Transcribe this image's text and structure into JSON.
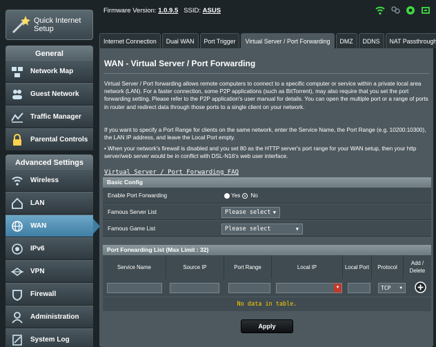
{
  "sidebar": {
    "quick_setup": "Quick Internet Setup",
    "general_header": "General",
    "general_items": [
      {
        "label": "Network Map",
        "icon": "network-map-icon"
      },
      {
        "label": "Guest Network",
        "icon": "guest-network-icon"
      },
      {
        "label": "Traffic Manager",
        "icon": "traffic-manager-icon"
      },
      {
        "label": "Parental Controls",
        "icon": "parental-controls-icon"
      }
    ],
    "advanced_header": "Advanced Settings",
    "advanced_items": [
      {
        "label": "Wireless",
        "icon": "wireless-icon"
      },
      {
        "label": "LAN",
        "icon": "lan-icon"
      },
      {
        "label": "WAN",
        "icon": "wan-icon",
        "active": true
      },
      {
        "label": "IPv6",
        "icon": "ipv6-icon"
      },
      {
        "label": "VPN",
        "icon": "vpn-icon"
      },
      {
        "label": "Firewall",
        "icon": "firewall-icon"
      },
      {
        "label": "Administration",
        "icon": "administration-icon"
      },
      {
        "label": "System Log",
        "icon": "system-log-icon"
      }
    ]
  },
  "header": {
    "firmware_label": "Firmware Version:",
    "firmware_value": "1.0.9.5",
    "ssid_label": "SSID:",
    "ssid_value": "ASUS"
  },
  "tabs": [
    {
      "label": "Internet Connection"
    },
    {
      "label": "Dual WAN"
    },
    {
      "label": "Port Trigger"
    },
    {
      "label": "Virtual Server / Port Forwarding",
      "active": true
    },
    {
      "label": "DMZ"
    },
    {
      "label": "DDNS"
    },
    {
      "label": "NAT Passthrough"
    }
  ],
  "main": {
    "title": "WAN - Virtual Server / Port Forwarding",
    "desc1": "Virtual Server / Port forwarding allows remote computers to connect to a specific computer or service within a private local area network (LAN). For a faster connection, some P2P applications (such as BitTorrent), may also require that you set the port forwarding setting. Please refer to the P2P application's user manual for details. You can open the multiple port or a range of ports in router and redirect data through those ports to a single client on your network.",
    "desc2": "If you want to specify a Port Range for clients on the same network, enter the Service Name, the Port Range (e.g. 10200:10300), the LAN IP address, and leave the Local Port empty.",
    "note": "• When your network's firewall is disabled and you set 80 as the HTTP server's port range for your WAN setup, then your http server/web server would be in conflict with DSL-N16's web user interface.",
    "faq_link": "Virtual Server / Port Forwarding FAQ"
  },
  "basic_config": {
    "header": "Basic Config",
    "enable_label": "Enable Port Forwarding",
    "yes_label": "Yes",
    "no_label": "No",
    "server_list_label": "Famous Server List",
    "server_list_value": "Please select",
    "game_list_label": "Famous Game List",
    "game_list_value": "Please select"
  },
  "pf_list": {
    "header": "Port Forwarding List (Max Limit : 32)",
    "columns": [
      "Service Name",
      "Source IP",
      "Port Range",
      "Local IP",
      "Local Port",
      "Protocol",
      "Add / Delete"
    ],
    "protocol_value": "TCP",
    "empty_text": "No data in table."
  },
  "apply_label": "Apply"
}
